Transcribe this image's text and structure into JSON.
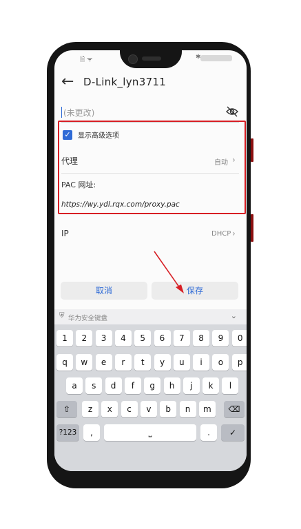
{
  "status_bar": {
    "left_icons": "🗎 ᯤ",
    "bluetooth": "✱"
  },
  "header": {
    "back_icon": "back-arrow-icon",
    "title": "D-Link_lyn3711"
  },
  "password": {
    "placeholder": "(未更改)"
  },
  "advanced": {
    "checkbox_label": "显示高级选项",
    "checked": true,
    "proxy_label": "代理",
    "proxy_value": "自动",
    "pac_label": "PAC 网址:",
    "pac_url": "https://wy.ydl.rqx.com/proxy.pac"
  },
  "ip": {
    "label": "IP",
    "value": "DHCP"
  },
  "actions": {
    "cancel": "取消",
    "save": "保存"
  },
  "keyboard": {
    "bar_label": "华为安全键盘",
    "row1": [
      "1",
      "2",
      "3",
      "4",
      "5",
      "6",
      "7",
      "8",
      "9",
      "0"
    ],
    "row2": [
      "q",
      "w",
      "e",
      "r",
      "t",
      "y",
      "u",
      "i",
      "o",
      "p"
    ],
    "row3": [
      "a",
      "s",
      "d",
      "f",
      "g",
      "h",
      "j",
      "k",
      "l"
    ],
    "row4": [
      "z",
      "x",
      "c",
      "v",
      "b",
      "n",
      "m"
    ],
    "symbols": "?123",
    "comma": ",",
    "period": "."
  },
  "colors": {
    "accent": "#2f6bd6",
    "annotation_red": "#d71e24"
  }
}
